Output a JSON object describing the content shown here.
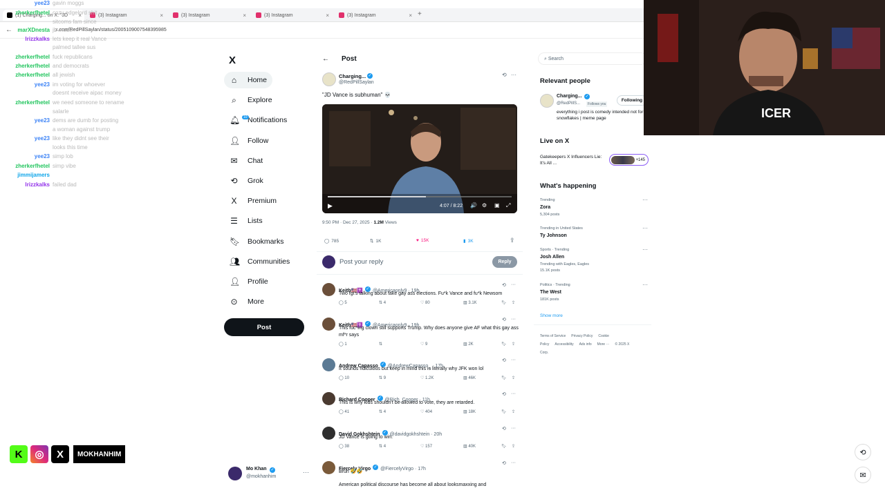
{
  "browser": {
    "tabs": [
      {
        "label": "(1) Charging... on X: \"JD",
        "active": true
      },
      {
        "label": "(3) Instagram"
      },
      {
        "label": "(3) Instagram"
      },
      {
        "label": "(3) Instagram"
      },
      {
        "label": "(3) Instagram"
      }
    ],
    "url": "x.com/RedPillSaylan/status/2005109007548395985"
  },
  "chat": [
    {
      "user": "yee23",
      "msg": "gavin moggs",
      "color": "#3b82f6"
    },
    {
      "user": "zherkerfhetel",
      "msg": "cozy edgelord shit",
      "color": "#22c55e"
    },
    {
      "user": "",
      "msg": "sitcoms fam since",
      "color": "#22c55e"
    },
    {
      "user": "marXDnesta",
      "msg": "jb mode",
      "color": "#22c55e"
    },
    {
      "user": "lrizzkalks",
      "msg": "lets keep it real Vance",
      "color": "#9333ea"
    },
    {
      "user": "",
      "msg": "palmed tallee sus",
      "color": "#9333ea"
    },
    {
      "user": "zherkerfhetel",
      "msg": "fuck republicans",
      "color": "#22c55e"
    },
    {
      "user": "zherkerfhetel",
      "msg": "and democrats",
      "color": "#22c55e"
    },
    {
      "user": "zherkerfhetel",
      "msg": "all jewish",
      "color": "#22c55e"
    },
    {
      "user": "yee23",
      "msg": "im voting for whoever",
      "color": "#3b82f6"
    },
    {
      "user": "",
      "msg": "doesnt receive aipac money",
      "color": "#3b82f6"
    },
    {
      "user": "zherkerfhetel",
      "msg": "we need someone to rename",
      "color": "#22c55e"
    },
    {
      "user": "",
      "msg": "salarle",
      "color": "#22c55e"
    },
    {
      "user": "yee23",
      "msg": "dems are dumb for posting",
      "color": "#3b82f6"
    },
    {
      "user": "",
      "msg": "a woman against trump",
      "color": "#3b82f6"
    },
    {
      "user": "yee23",
      "msg": "like they didnt see their",
      "color": "#3b82f6"
    },
    {
      "user": "",
      "msg": "looks this time",
      "color": "#3b82f6"
    },
    {
      "user": "yee23",
      "msg": "simp lob",
      "color": "#3b82f6"
    },
    {
      "user": "zherkerfhetel",
      "msg": "simp vibe",
      "color": "#22c55e"
    },
    {
      "user": "jimmijamers",
      "msg": "",
      "color": "#0ea5e9"
    },
    {
      "user": "lrizzkalks",
      "msg": "failed dad",
      "color": "#9333ea"
    }
  ],
  "nav": {
    "logo": "X",
    "items": [
      {
        "label": "Home",
        "icon": "home-icon"
      },
      {
        "label": "Explore",
        "icon": "search-icon"
      },
      {
        "label": "Notifications",
        "icon": "bell-icon",
        "badge": "10"
      },
      {
        "label": "Follow",
        "icon": "follow-icon"
      },
      {
        "label": "Chat",
        "icon": "chat-icon"
      },
      {
        "label": "Grok",
        "icon": "grok-icon"
      },
      {
        "label": "Premium",
        "icon": "x-icon"
      },
      {
        "label": "Lists",
        "icon": "list-icon"
      },
      {
        "label": "Bookmarks",
        "icon": "bookmark-icon"
      },
      {
        "label": "Communities",
        "icon": "communities-icon"
      },
      {
        "label": "Profile",
        "icon": "profile-icon"
      },
      {
        "label": "More",
        "icon": "more-icon"
      }
    ],
    "post_label": "Post",
    "account": {
      "name": "Mo Khan",
      "handle": "@mokhanhim"
    }
  },
  "post": {
    "header": "Post",
    "author": "Charging...",
    "handle": "@RedPillSaylan",
    "text": "\"JD Vance is subhuman\" 💀",
    "video_time": "4:07 / 8:22",
    "timestamp": "9:50 PM · Dec 27, 2025 · ",
    "views_count": "1.2M",
    "views_label": " Views",
    "stats": {
      "replies": "785",
      "reposts": "1K",
      "likes": "15K",
      "bookmarks": "3K"
    },
    "reply_placeholder": "Post your reply",
    "reply_button": "Reply"
  },
  "replies": [
    {
      "name": "Keith🇺🇸✝️",
      "handle": "@Americaonly9 · 19h",
      "text": "Two fgt's talking about fake gay ass elections. Fu*k Vance and fu*k Newsom",
      "stats": [
        "5",
        "4",
        "80",
        "3.1K"
      ],
      "color": "#6b4f3a"
    },
    {
      "name": "Keith🇺🇸✝️",
      "handle": "@Americaonly9 · 19h",
      "text": "This fuc*ing clown still supports Trump. Why does anyone give AF what this gay ass mf*r says",
      "stats": [
        "1",
        "",
        "9",
        "2K"
      ],
      "color": "#6b4f3a"
    },
    {
      "name": "Andrew Capasso",
      "handle": "@AndrewCapasso_ · 17h",
      "text": "It sounds ridiculous but keep in mind this is literally why JFK won lol",
      "stats": [
        "10",
        "9",
        "1.2K",
        "46K"
      ],
      "color": "#5b7a94"
    },
    {
      "name": "Richard Cooper",
      "handle": "@Rich_Cooper · 11h",
      "text": "This is why kids shouldn't be allowed to vote, they are retarded.",
      "stats": [
        "41",
        "4",
        "404",
        "18K"
      ],
      "color": "#4a3a30"
    },
    {
      "name": "David Gokhshtein",
      "handle": "@davidgokhshtein · 20h",
      "text": "JD Vance is going to win.",
      "stats": [
        "38",
        "4",
        "157",
        "40K"
      ],
      "color": "#2e2e2e"
    },
    {
      "name": "Fiercely Virgo",
      "handle": "@FiercelyVirgo · 17h",
      "text": "Bruh 🤣🤣",
      "stats": [],
      "color": "#7a5a3a"
    }
  ],
  "last_text": "American political discourse has become all about looksmaxxing and",
  "right": {
    "search_placeholder": "Search",
    "relevant_title": "Relevant people",
    "person": {
      "name": "Charging...",
      "handle": "@RedPillS...",
      "follows": "Follows you",
      "button": "Following",
      "bio": "everything i post is comedy intended not for snowflakes | meme page"
    },
    "live_title": "Live on X",
    "live_item": "Gatekeepers X Influencers Lie: It's All ...",
    "live_count": "+145",
    "happening_title": "What's happening",
    "trends": [
      {
        "meta": "Trending",
        "name": "Zora",
        "count": "5,304 posts"
      },
      {
        "meta": "Trending in United States",
        "name": "Ty Johnson",
        "count": ""
      },
      {
        "meta": "Sports · Trending",
        "name": "Josh Allen",
        "count": "15.1K posts",
        "extra": "Trending with Eagles, Eagles"
      },
      {
        "meta": "Politics · Trending",
        "name": "The West",
        "count": "181K posts"
      }
    ],
    "show_more": "Show more",
    "footer": [
      "Terms of Service",
      "Privacy Policy",
      "Cookie Policy",
      "Accessibility",
      "Ads info",
      "More ···",
      "© 2025 X Corp."
    ]
  },
  "social": {
    "name": "MOKHANHIM"
  },
  "colors": {
    "accent": "#1d9bf0",
    "like": "#f91880"
  }
}
